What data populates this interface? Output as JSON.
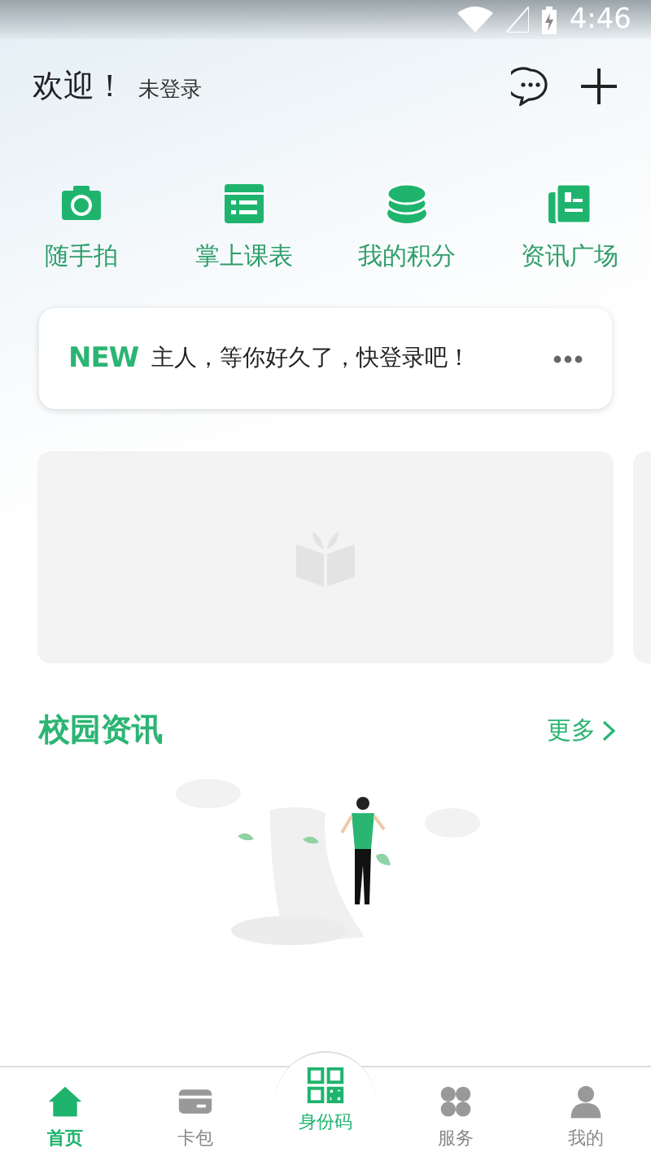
{
  "status_bar": {
    "time": "4:46"
  },
  "header": {
    "greeting": "欢迎！",
    "login_status": "未登录"
  },
  "shortcuts": [
    {
      "label": "随手拍",
      "kind": "camera"
    },
    {
      "label": "掌上课表",
      "kind": "schedule"
    },
    {
      "label": "我的积分",
      "kind": "points"
    },
    {
      "label": "资讯广场",
      "kind": "news"
    }
  ],
  "notice": {
    "badge": "NEW",
    "text": "主人，等你好久了，快登录吧！"
  },
  "news": {
    "title": "校园资讯",
    "more": "更多"
  },
  "tab_bar": [
    {
      "label": "首页",
      "kind": "home",
      "selected": true
    },
    {
      "label": "卡包",
      "kind": "card",
      "selected": false
    },
    {
      "label": "身份码",
      "kind": "qr",
      "selected": false
    },
    {
      "label": "服务",
      "kind": "service",
      "selected": false
    },
    {
      "label": "我的",
      "kind": "me",
      "selected": false
    }
  ]
}
